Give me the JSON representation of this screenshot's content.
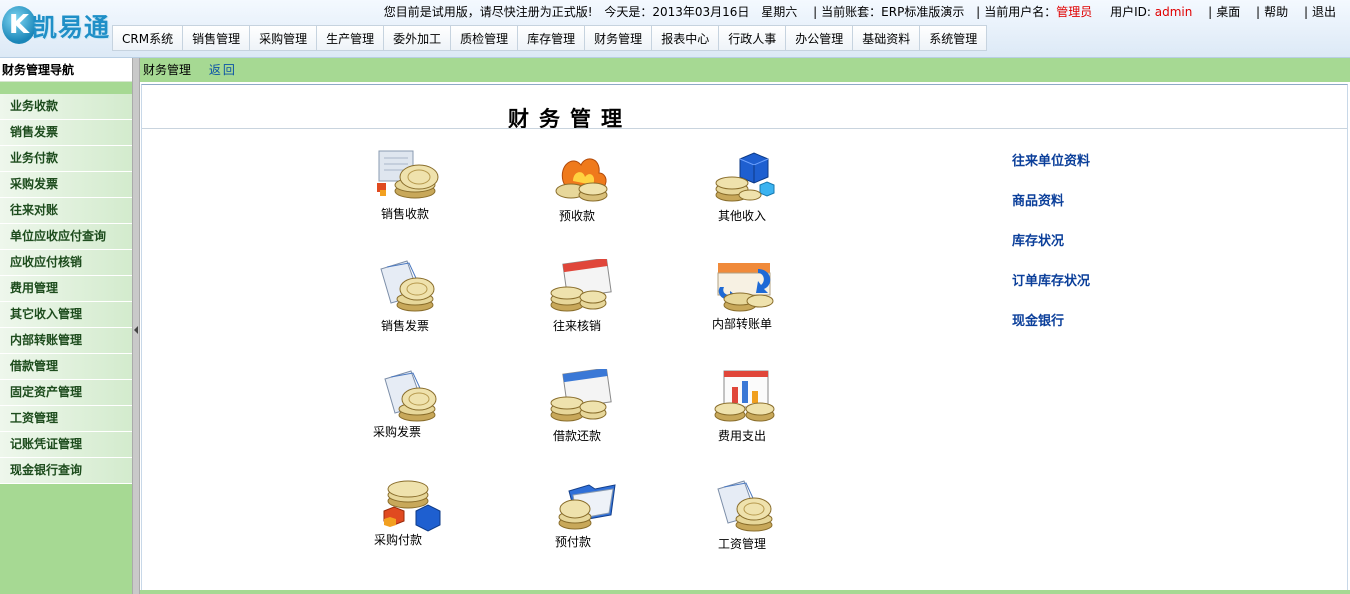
{
  "app": {
    "logo_letter": "K",
    "logo_name": "凯易通"
  },
  "infobar": {
    "trial_notice": "您目前是试用版，请尽快注册为正式版!",
    "today_label": "今天是：",
    "date": "2013年03月16日",
    "weekday": "星期六",
    "account_label": "当前账套：",
    "account": "ERP标准版演示",
    "user_label": "当前用户名：",
    "user_name": "管理员",
    "uid_label": "用户ID: ",
    "uid": "admin",
    "desktop": "桌面",
    "help": "帮助",
    "logout": "退出"
  },
  "topnav": [
    "CRM系统",
    "销售管理",
    "采购管理",
    "生产管理",
    "委外加工",
    "质检管理",
    "库存管理",
    "财务管理",
    "报表中心",
    "行政人事",
    "办公管理",
    "基础资料",
    "系统管理"
  ],
  "sidebar": {
    "title": "财务管理导航",
    "items": [
      "业务收款",
      "销售发票",
      "业务付款",
      "采购发票",
      "往来对账",
      "单位应收应付查询",
      "应收应付核销",
      "费用管理",
      "其它收入管理",
      "内部转账管理",
      "借款管理",
      "固定资产管理",
      "工资管理",
      "记账凭证管理",
      "现金银行查询"
    ]
  },
  "breadcrumb": {
    "current": "财务管理",
    "back": "返回"
  },
  "main": {
    "title": "财务管理",
    "modules": [
      {
        "label": "销售收款",
        "icon": "coins-document-icon"
      },
      {
        "label": "预收款",
        "icon": "coins-fire-icon"
      },
      {
        "label": "其他收入",
        "icon": "coins-cube-icon"
      },
      {
        "label": "销售发票",
        "icon": "invoice-coins-icon"
      },
      {
        "label": "往来核销",
        "icon": "calendar-coins-icon"
      },
      {
        "label": "内部转账单",
        "icon": "transfer-coins-icon"
      },
      {
        "label": "采购发票",
        "icon": "invoice-coins-icon"
      },
      {
        "label": "借款还款",
        "icon": "calendar-coins-icon"
      },
      {
        "label": "费用支出",
        "icon": "chart-coins-icon"
      },
      {
        "label": "采购付款",
        "icon": "coins-cube-icon"
      },
      {
        "label": "预付款",
        "icon": "folder-coins-icon"
      },
      {
        "label": "工资管理",
        "icon": "invoice-coins-icon"
      }
    ],
    "quick_links": [
      "往来单位资料",
      "商品资料",
      "库存状况",
      "订单库存状况",
      "现金银行"
    ]
  },
  "colors": {
    "sidebar_green": "#a6d993",
    "link_blue": "#0b3f9a",
    "alert_red": "#e00000",
    "coin_gold": "#d9c07a"
  }
}
